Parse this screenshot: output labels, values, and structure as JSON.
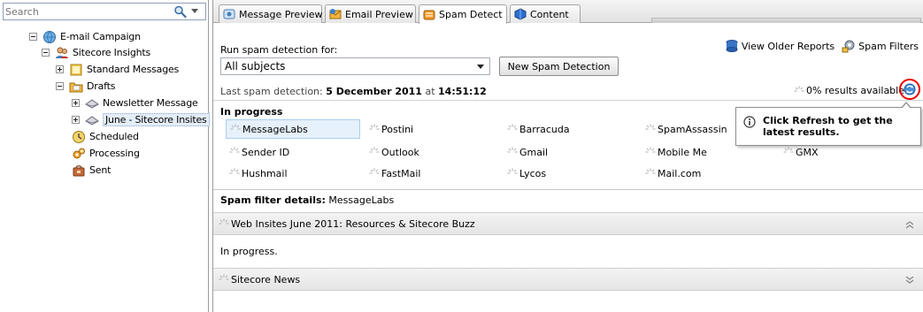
{
  "search": {
    "placeholder": "Search",
    "value": ""
  },
  "tree": {
    "items": [
      {
        "label": "E-mail Campaign",
        "icon": "globe-mail-icon"
      },
      {
        "label": "Sitecore Insights",
        "icon": "users-folder-icon"
      },
      {
        "label": "Standard Messages",
        "icon": "folder-icon"
      },
      {
        "label": "Drafts",
        "icon": "drafts-folder-icon"
      },
      {
        "label": "Newsletter Message",
        "icon": "envelope-icon"
      },
      {
        "label": "June - Sitecore Insites",
        "icon": "envelope-icon"
      },
      {
        "label": "Scheduled",
        "icon": "clock-icon"
      },
      {
        "label": "Processing",
        "icon": "gears-icon"
      },
      {
        "label": "Sent",
        "icon": "sent-icon"
      }
    ]
  },
  "tabs": [
    {
      "label": "Message Preview",
      "icon": "preview-icon"
    },
    {
      "label": "Email Preview",
      "icon": "email-preview-icon"
    },
    {
      "label": "Spam Detect",
      "icon": "spam-detect-icon"
    },
    {
      "label": "Content",
      "icon": "content-icon"
    }
  ],
  "spam": {
    "run_label": "Run spam detection for:",
    "subject_selected": "All subjects",
    "new_button": "New Spam Detection",
    "view_older": "View Older Reports",
    "spam_filters": "Spam Filters",
    "last_label": "Last spam detection:",
    "last_date": "5 December 2011",
    "at_label": "at",
    "last_time": "14:51:12",
    "results": "0% results available",
    "section_head": "In progress",
    "filters": [
      "MessageLabs",
      "Postini",
      "Barracuda",
      "SpamAssassin",
      "Sender ID",
      "Outlook",
      "Gmail",
      "Mobile Me",
      "GMX",
      "Hushmail",
      "FastMail",
      "Lycos",
      "Mail.com"
    ],
    "tooltip": "Click Refresh to get the latest results.",
    "details_label": "Spam filter details:",
    "details_value": "MessageLabs",
    "accordion": [
      {
        "title": "Web Insites June 2011: Resources & Sitecore Buzz",
        "body": "In progress.",
        "state": "expanded"
      },
      {
        "title": "Sitecore News",
        "body": "",
        "state": "collapsed"
      }
    ]
  },
  "colors": {
    "refresh_highlight": "#e00000",
    "selected_bg": "#e6f1fb",
    "tab_bg": "#e2e2e2"
  }
}
